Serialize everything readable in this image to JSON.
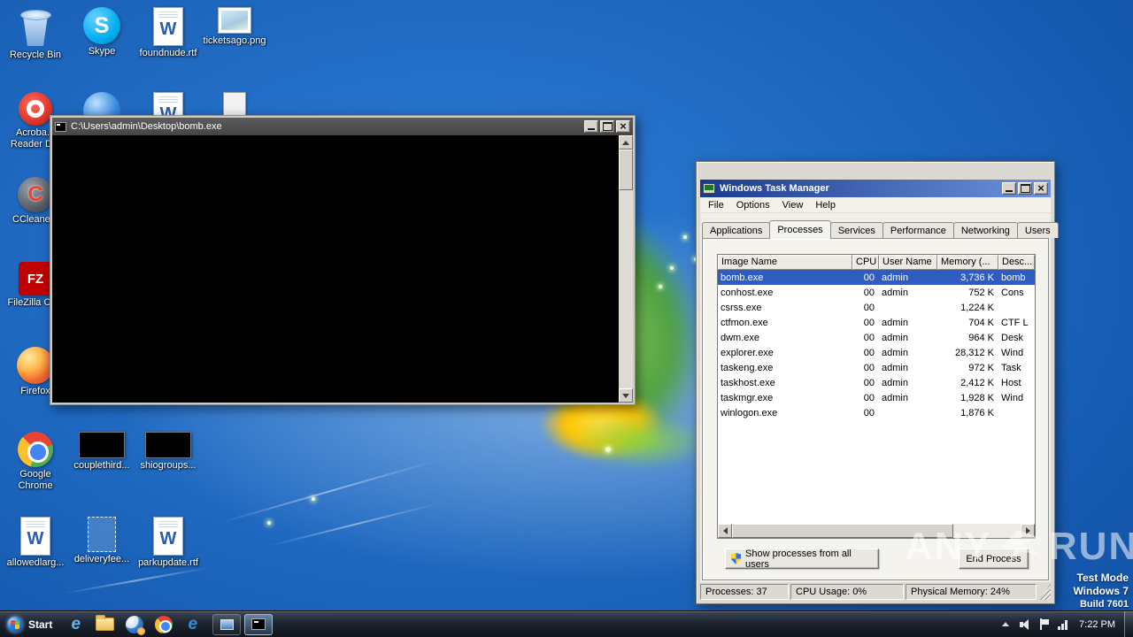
{
  "desktop": {
    "icons": [
      {
        "label": "Recycle Bin",
        "icon": "recycle-bin",
        "col": 0,
        "row": 0
      },
      {
        "label": "Skype",
        "icon": "skype",
        "col": 1,
        "row": 0
      },
      {
        "label": "foundnude.rtf",
        "icon": "word-doc",
        "col": 2,
        "row": 0
      },
      {
        "label": "ticketsago.png",
        "icon": "image-file",
        "col": 3,
        "row": 0
      },
      {
        "label": "Acroba...\nReader D...",
        "icon": "acrobat",
        "col": 0,
        "row": 1
      },
      {
        "label": "",
        "icon": "app-circle",
        "col": 1,
        "row": 1
      },
      {
        "label": "",
        "icon": "word-doc",
        "col": 2,
        "row": 1
      },
      {
        "label": "",
        "icon": "file-generic",
        "col": 3,
        "row": 1
      },
      {
        "label": "CCleane...",
        "icon": "ccleaner",
        "col": 0,
        "row": 2
      },
      {
        "label": "FileZilla Cli...",
        "icon": "filezilla",
        "col": 0,
        "row": 3
      },
      {
        "label": "Firefox",
        "icon": "firefox",
        "col": 0,
        "row": 4
      },
      {
        "label": "Google Chrome",
        "icon": "chrome",
        "col": 0,
        "row": 5
      },
      {
        "label": "couplethird...",
        "icon": "black-thumb",
        "col": 1,
        "row": 5
      },
      {
        "label": "shiogroups...",
        "icon": "black-thumb",
        "col": 2,
        "row": 5
      },
      {
        "label": "allowedlarg...",
        "icon": "word-doc",
        "col": 0,
        "row": 6
      },
      {
        "label": "deliveryfee...",
        "icon": "ghost-file",
        "col": 1,
        "row": 6
      },
      {
        "label": "parkupdate.rtf",
        "icon": "word-doc",
        "col": 2,
        "row": 6
      }
    ]
  },
  "cmd_window": {
    "title": "C:\\Users\\admin\\Desktop\\bomb.exe"
  },
  "task_manager": {
    "title": "Windows Task Manager",
    "menu": [
      "File",
      "Options",
      "View",
      "Help"
    ],
    "tabs": [
      "Applications",
      "Processes",
      "Services",
      "Performance",
      "Networking",
      "Users"
    ],
    "active_tab": "Processes",
    "columns": [
      "Image Name",
      "CPU",
      "User Name",
      "Memory (...",
      "Desc..."
    ],
    "processes": [
      {
        "image": "bomb.exe",
        "cpu": "00",
        "user": "admin",
        "memory": "3,736 K",
        "desc": "bomb",
        "selected": true
      },
      {
        "image": "conhost.exe",
        "cpu": "00",
        "user": "admin",
        "memory": "752 K",
        "desc": "Cons"
      },
      {
        "image": "csrss.exe",
        "cpu": "00",
        "user": "",
        "memory": "1,224 K",
        "desc": ""
      },
      {
        "image": "ctfmon.exe",
        "cpu": "00",
        "user": "admin",
        "memory": "704 K",
        "desc": "CTF L"
      },
      {
        "image": "dwm.exe",
        "cpu": "00",
        "user": "admin",
        "memory": "964 K",
        "desc": "Desk"
      },
      {
        "image": "explorer.exe",
        "cpu": "00",
        "user": "admin",
        "memory": "28,312 K",
        "desc": "Wind"
      },
      {
        "image": "taskeng.exe",
        "cpu": "00",
        "user": "admin",
        "memory": "972 K",
        "desc": "Task"
      },
      {
        "image": "taskhost.exe",
        "cpu": "00",
        "user": "admin",
        "memory": "2,412 K",
        "desc": "Host"
      },
      {
        "image": "taskmgr.exe",
        "cpu": "00",
        "user": "admin",
        "memory": "1,928 K",
        "desc": "Wind"
      },
      {
        "image": "winlogon.exe",
        "cpu": "00",
        "user": "",
        "memory": "1,876 K",
        "desc": ""
      }
    ],
    "buttons": {
      "show_all": "Show processes from all users",
      "end_process": "End Process"
    },
    "status": {
      "processes": "Processes: 37",
      "cpu_usage": "CPU Usage: 0%",
      "physical_memory": "Physical Memory: 24%"
    }
  },
  "taskbar": {
    "start_label": "Start",
    "quick_launch": [
      "ie",
      "folder",
      "media-player",
      "chrome",
      "edge"
    ],
    "window_buttons": [
      {
        "icon": "window",
        "active": false
      },
      {
        "icon": "cmd",
        "active": true
      }
    ],
    "time": "7:22 PM"
  },
  "watermark": {
    "brand_left": "ANY",
    "brand_right": "RUN",
    "mode": "Test Mode",
    "os": "Windows 7",
    "build": "Build 7601"
  }
}
